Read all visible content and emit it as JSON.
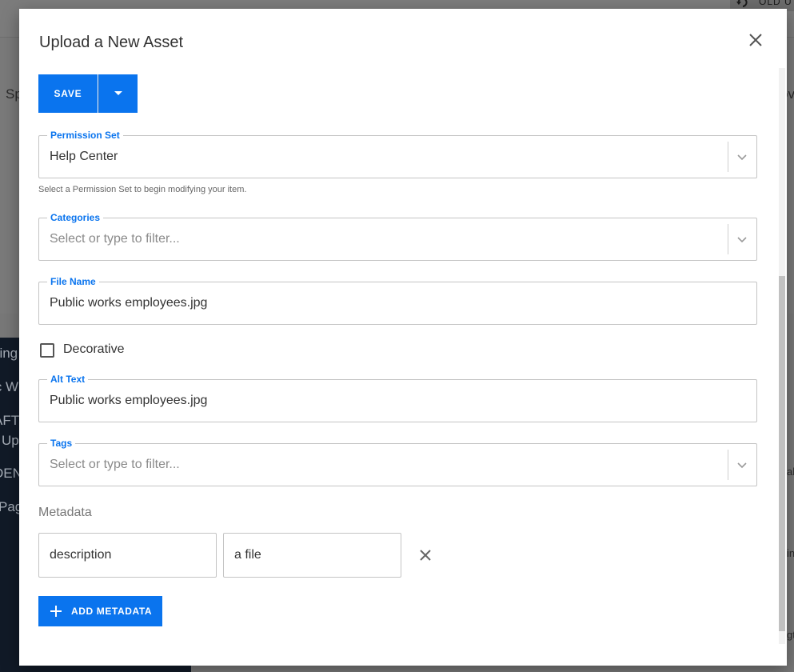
{
  "background": {
    "header_text": "OLD U",
    "main_left_text": "Sp",
    "main_right_text": "ov",
    "sidebar_items": [
      "hing",
      "ic W",
      "AFT",
      "Up",
      "DEN",
      "Pag"
    ],
    "right_edge_texts": [
      "al",
      "in",
      "gt"
    ]
  },
  "modal": {
    "title": "Upload a New Asset",
    "save_label": "SAVE",
    "permission_set": {
      "label": "Permission Set",
      "value": "Help Center",
      "helper": "Select a Permission Set to begin modifying your item."
    },
    "categories": {
      "label": "Categories",
      "placeholder": "Select or type to filter..."
    },
    "file_name": {
      "label": "File Name",
      "value": "Public works employees.jpg"
    },
    "decorative": {
      "label": "Decorative",
      "checked": false
    },
    "alt_text": {
      "label": "Alt Text",
      "value": "Public works employees.jpg"
    },
    "tags": {
      "label": "Tags",
      "placeholder": "Select or type to filter..."
    },
    "metadata": {
      "title": "Metadata",
      "rows": [
        {
          "key": "description",
          "value": "a file"
        }
      ],
      "add_label": "ADD METADATA"
    }
  },
  "colors": {
    "primary": "#0a74ee",
    "overlay": "#7a7a7a",
    "sidebar": "#111a27"
  },
  "icons": [
    "undo-icon",
    "close-icon",
    "caret-down-icon",
    "chevron-down-icon",
    "checkbox-icon",
    "remove-icon",
    "plus-icon"
  ]
}
